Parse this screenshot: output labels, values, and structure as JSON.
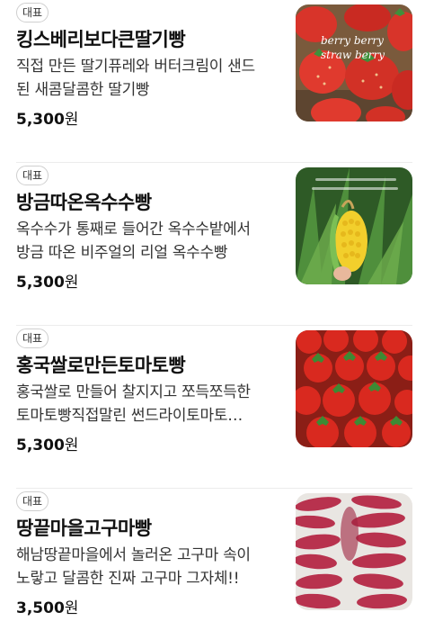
{
  "items": [
    {
      "badge": "대표",
      "title": "킹스베리보다큰딸기빵",
      "desc_line1": "직접 만든 딸기퓨레와 버터크림이 샌드",
      "desc_line2": "된 새콤달콤한 딸기빵",
      "price_number": "5,300",
      "price_unit": "원",
      "image_text_1": "berry berry",
      "image_text_2": "straw berry"
    },
    {
      "badge": "대표",
      "title": "방금따온옥수수빵",
      "desc_line1": "옥수수가 통째로 들어간 옥수수밭에서",
      "desc_line2": "방금 따온 비주얼의 리얼 옥수수빵",
      "price_number": "5,300",
      "price_unit": "원"
    },
    {
      "badge": "대표",
      "title": "홍국쌀로만든토마토빵",
      "desc_line1": "홍국쌀로 만들어 찰지지고 쪼득쪼득한",
      "desc_line2": "토마토빵직접말린 썬드라이토마토…",
      "price_number": "5,300",
      "price_unit": "원"
    },
    {
      "badge": "대표",
      "title": "땅끝마을고구마빵",
      "desc_line1": "해남땅끝마을에서 놀러온 고구마 속이",
      "desc_line2": "노랗고 달콤한 진짜 고구마 그자체!!",
      "price_number": "3,500",
      "price_unit": "원"
    }
  ]
}
